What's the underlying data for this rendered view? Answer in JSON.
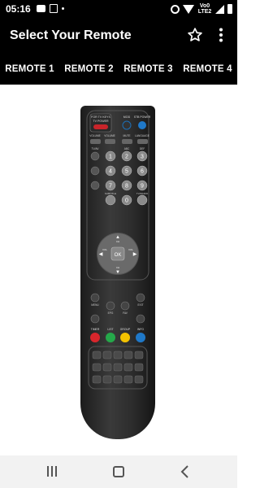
{
  "status_bar": {
    "time": "05:16",
    "network_label": "Vo0 LTE2",
    "icons": [
      "chat-icon",
      "image-icon",
      "dot-icon",
      "alarm-icon",
      "wifi-icon",
      "signal-icon",
      "battery-icon"
    ]
  },
  "app_bar": {
    "title": "Select Your Remote",
    "actions": [
      "star-icon",
      "more-vert-icon"
    ]
  },
  "tabs": [
    {
      "label": "REMOTE 1"
    },
    {
      "label": "REMOTE 2"
    },
    {
      "label": "REMOTE 3"
    },
    {
      "label": "REMOTE 4"
    }
  ],
  "remote": {
    "top_label_1": "FOR TV KEYS",
    "top_label_2": "TV POWER",
    "row1": [
      "MOD",
      "STB POWER"
    ],
    "row2": [
      "VOLUME",
      "VOLUME",
      "MUTE",
      "LANGUAGE"
    ],
    "row3": [
      "TV/AV",
      "",
      "ABC",
      "DEF"
    ],
    "keypad": [
      "1",
      "2",
      "3",
      "4",
      "5",
      "6",
      "7",
      "8",
      "9",
      "SUBTITLE",
      "0",
      "TV/RADIO"
    ],
    "nav": {
      "up": "CH",
      "down": "CH",
      "left": "VOL",
      "right": "VOL",
      "ok": "OK"
    },
    "menu_row": [
      "MENU",
      "EPG",
      "FAV",
      "EXIT"
    ],
    "color_row": [
      "TIMER",
      "LIST",
      "GROUP",
      "INFO"
    ],
    "colors": {
      "red": "#d9262c",
      "green": "#25a84a",
      "yellow": "#f2c200",
      "blue": "#1f78c8"
    }
  },
  "nav_bar": {
    "buttons": [
      "recents-icon",
      "home-icon",
      "back-icon"
    ]
  }
}
